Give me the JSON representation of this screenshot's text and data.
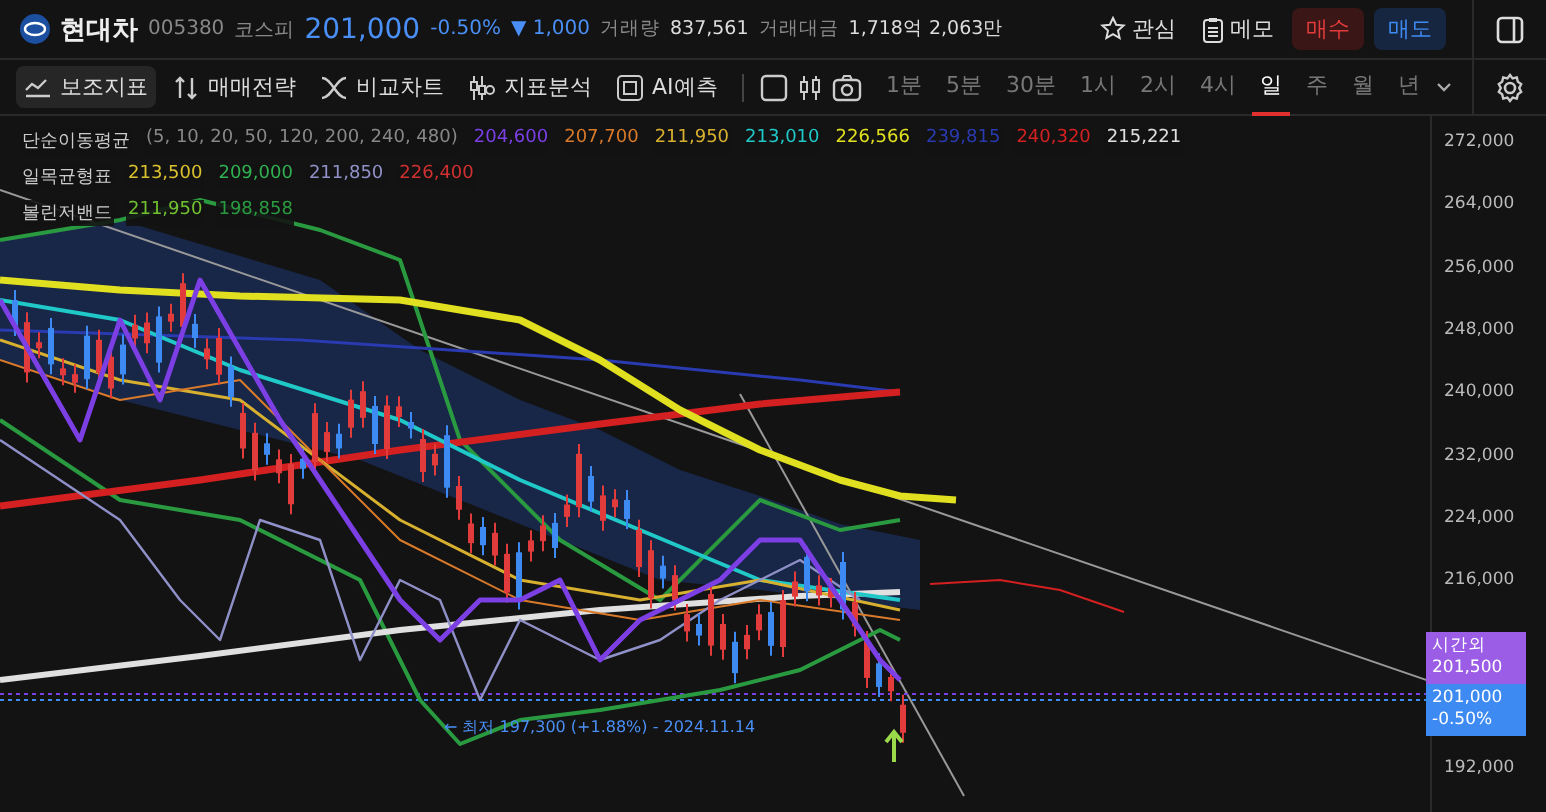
{
  "header": {
    "name": "현대차",
    "code": "005380",
    "market": "코스피",
    "price": "201,000",
    "change_pct": "-0.50%",
    "change_arrow": "▼",
    "change": "1,000",
    "volume_label": "거래량",
    "volume": "837,561",
    "amount_label": "거래대금",
    "amount": "1,718억 2,063만",
    "watch": "관심",
    "memo": "메모",
    "buy": "매수",
    "sell": "매도"
  },
  "toolbar": {
    "tools": [
      {
        "label": "보조지표",
        "selected": true,
        "kind": "indicator"
      },
      {
        "label": "매매전략",
        "selected": false,
        "kind": "strategy"
      },
      {
        "label": "비교차트",
        "selected": false,
        "kind": "compare"
      },
      {
        "label": "지표분석",
        "selected": false,
        "kind": "analysis"
      },
      {
        "label": "AI예측",
        "selected": false,
        "kind": "ai"
      }
    ],
    "periods": [
      {
        "label": "1분",
        "selected": false
      },
      {
        "label": "5분",
        "selected": false
      },
      {
        "label": "30분",
        "selected": false
      },
      {
        "label": "1시",
        "selected": false
      },
      {
        "label": "2시",
        "selected": false
      },
      {
        "label": "4시",
        "selected": false
      },
      {
        "label": "일",
        "selected": true
      },
      {
        "label": "주",
        "selected": false
      },
      {
        "label": "월",
        "selected": false
      },
      {
        "label": "년",
        "selected": false
      }
    ]
  },
  "legend": [
    {
      "name": "단순이동평균",
      "params": "(5, 10, 20, 50, 120, 200, 240, 480)",
      "values": [
        {
          "text": "204,600",
          "color": "#7b3fe4"
        },
        {
          "text": "207,700",
          "color": "#d97a2b"
        },
        {
          "text": "211,950",
          "color": "#d8b030"
        },
        {
          "text": "213,010",
          "color": "#20c8c8"
        },
        {
          "text": "226,566",
          "color": "#e0e020"
        },
        {
          "text": "239,815",
          "color": "#2a3ab0"
        },
        {
          "text": "240,320",
          "color": "#d42020"
        },
        {
          "text": "215,221",
          "color": "#e0e0e0"
        }
      ]
    },
    {
      "name": "일목균형표",
      "values": [
        {
          "text": "213,500",
          "color": "#d8c030"
        },
        {
          "text": "209,000",
          "color": "#30b050"
        },
        {
          "text": "211,850",
          "color": "#9090c8"
        },
        {
          "text": "226,400",
          "color": "#d03030"
        }
      ]
    },
    {
      "name": "볼린저밴드",
      "values": [
        {
          "text": "211,950",
          "color": "#70c030"
        },
        {
          "text": "198,858",
          "color": "#2a9a40"
        }
      ]
    }
  ],
  "axis": {
    "ticks": [
      "272,000",
      "264,000",
      "256,000",
      "248,000",
      "240,000",
      "232,000",
      "224,000",
      "216,000",
      "192,000"
    ]
  },
  "price_tags": [
    {
      "kind": "afterhours",
      "label": "시간외",
      "price": "201,500"
    },
    {
      "kind": "current",
      "price": "201,000",
      "change": "-0.50%"
    }
  ],
  "low_marker": {
    "arrow": "←",
    "text": "최저 197,300 (+1.88%) - 2024.11.14"
  }
}
